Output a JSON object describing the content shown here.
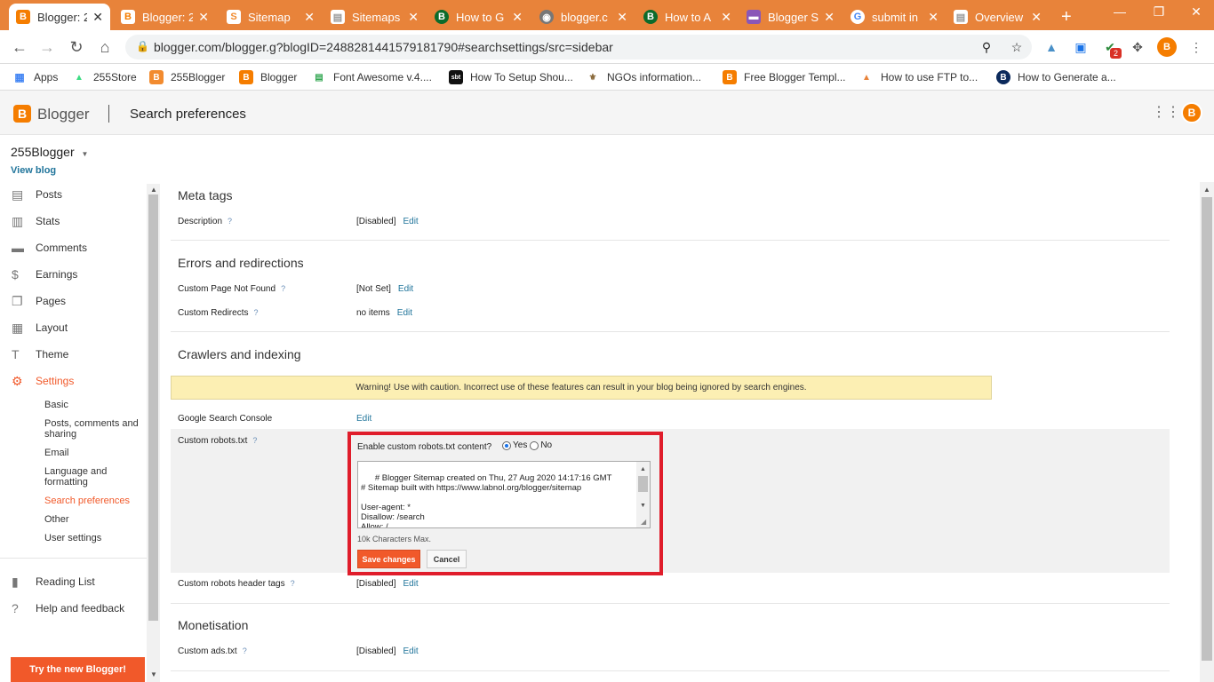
{
  "browser": {
    "tabs": [
      {
        "title": "Blogger: 2",
        "icon": "blogger-icon"
      },
      {
        "title": "Blogger: 2",
        "icon": "blogger-icon"
      },
      {
        "title": "Sitemap",
        "icon": "sitemap-icon"
      },
      {
        "title": "Sitemaps",
        "icon": "sitemap-icon"
      },
      {
        "title": "How to G",
        "icon": "b-logo-icon"
      },
      {
        "title": "blogger.c",
        "icon": "globe-icon"
      },
      {
        "title": "How to A",
        "icon": "b-logo-icon"
      },
      {
        "title": "Blogger S",
        "icon": "purple-icon"
      },
      {
        "title": "submit in",
        "icon": "google-icon"
      },
      {
        "title": "Overview",
        "icon": "doc-icon"
      }
    ],
    "new_tab": "+",
    "url": "blogger.com/blogger.g?blogID=2488281441579181790#searchsettings/src=sidebar",
    "extension_badge": "2",
    "bookmarks": [
      {
        "label": "Apps"
      },
      {
        "label": "255Store"
      },
      {
        "label": "255Blogger"
      },
      {
        "label": "Blogger"
      },
      {
        "label": "Font Awesome v.4...."
      },
      {
        "label": "How To Setup Shou..."
      },
      {
        "label": "NGOs information..."
      },
      {
        "label": "Free Blogger Templ..."
      },
      {
        "label": "How to use FTP to..."
      },
      {
        "label": "How to Generate a..."
      }
    ]
  },
  "app": {
    "brand": "Blogger",
    "page_title": "Search preferences",
    "accent": "#f1592a"
  },
  "sidebar": {
    "blog_name": "255Blogger",
    "view_blog": "View blog",
    "items": [
      {
        "label": "Posts",
        "icon": "posts-icon"
      },
      {
        "label": "Stats",
        "icon": "stats-icon"
      },
      {
        "label": "Comments",
        "icon": "comments-icon"
      },
      {
        "label": "Earnings",
        "icon": "dollar-icon"
      },
      {
        "label": "Pages",
        "icon": "pages-icon"
      },
      {
        "label": "Layout",
        "icon": "layout-icon"
      },
      {
        "label": "Theme",
        "icon": "theme-icon"
      },
      {
        "label": "Settings",
        "icon": "gear-icon"
      }
    ],
    "settings_sub": [
      "Basic",
      "Posts, comments and sharing",
      "Email",
      "Language and formatting",
      "Search preferences",
      "Other",
      "User settings"
    ],
    "reading_list": "Reading List",
    "help": "Help and feedback",
    "try_new": "Try the new Blogger!"
  },
  "main": {
    "meta_tags": {
      "title": "Meta tags",
      "description_label": "Description",
      "description_value": "[Disabled]"
    },
    "errors": {
      "title": "Errors and redirections",
      "not_found_label": "Custom Page Not Found",
      "not_found_value": "[Not Set]",
      "redirects_label": "Custom Redirects",
      "redirects_value": "no items"
    },
    "crawlers": {
      "title": "Crawlers and indexing",
      "warning": "Warning! Use with caution. Incorrect use of these features can result in your blog being ignored by search engines.",
      "gsc_label": "Google Search Console",
      "robots_label": "Custom robots.txt",
      "robots_question": "Enable custom robots.txt content?",
      "yes": "Yes",
      "no": "No",
      "robots_content": "# Blogger Sitemap created on Thu, 27 Aug 2020 14:17:16 GMT\n# Sitemap built with https://www.labnol.org/blogger/sitemap\n\nUser-agent: *\nDisallow: /search\nAllow: /",
      "limit": "10k Characters Max.",
      "save": "Save changes",
      "cancel": "Cancel",
      "header_tags_label": "Custom robots header tags",
      "header_tags_value": "[Disabled]"
    },
    "monetisation": {
      "title": "Monetisation",
      "ads_label": "Custom ads.txt",
      "ads_value": "[Disabled]"
    },
    "edit": "Edit",
    "help_mark": "?"
  }
}
